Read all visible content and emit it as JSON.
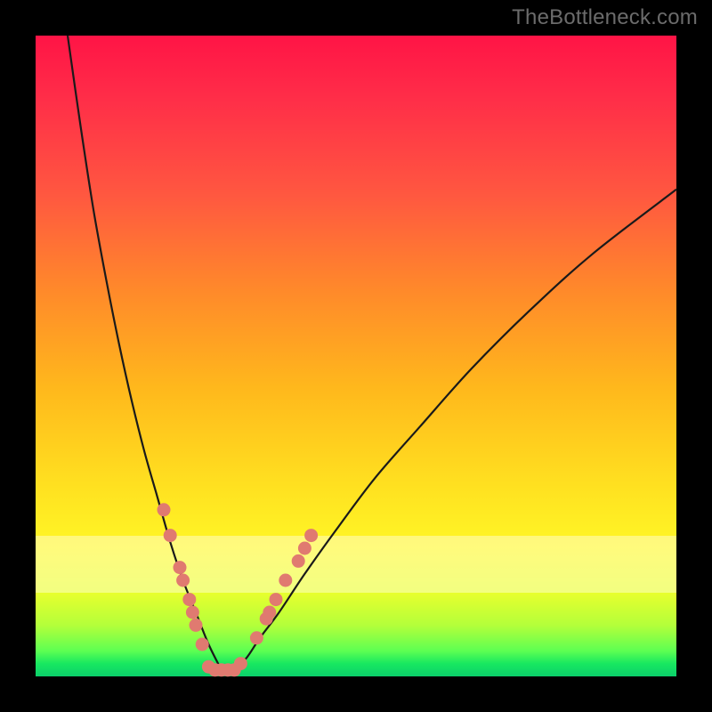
{
  "watermark": "TheBottleneck.com",
  "colors": {
    "background_frame": "#000000",
    "gradient_top": "#ff1446",
    "gradient_mid1": "#ff8a2a",
    "gradient_mid2": "#ffe020",
    "gradient_bottom": "#0bcf6a",
    "curve": "#1a1a1a",
    "marker": "#e07a70"
  },
  "chart_data": {
    "type": "line",
    "title": "",
    "xlabel": "",
    "ylabel": "",
    "xlim": [
      0,
      100
    ],
    "ylim": [
      0,
      100
    ],
    "grid": false,
    "legend": false,
    "annotations": [
      "TheBottleneck.com"
    ],
    "comment": "V-shaped bottleneck curve. y ≈ 100 is bottom of image (green/good, 0% bottleneck); y ≈ 0 is top (red/bad, 100% bottleneck). Minimum of the curve (best match) occurs around x ≈ 27–31. Left branch falls steeply from top-left; right branch rises more gently toward upper-right.",
    "series": [
      {
        "name": "bottleneck-curve-left-branch",
        "x": [
          5,
          7,
          9,
          11,
          13,
          15,
          17,
          19,
          21,
          23,
          25,
          27,
          29
        ],
        "y": [
          0,
          14,
          27,
          38,
          48,
          57,
          65,
          72,
          79,
          85,
          90,
          95,
          99
        ]
      },
      {
        "name": "bottleneck-curve-right-branch",
        "x": [
          29,
          31,
          33,
          35,
          38,
          42,
          47,
          53,
          60,
          68,
          77,
          87,
          100
        ],
        "y": [
          99,
          99,
          97,
          94,
          90,
          84,
          77,
          69,
          61,
          52,
          43,
          34,
          24
        ]
      }
    ],
    "markers": {
      "comment": "Salmon-colored dots and short segments clustered near the bottom of the V on both branches.",
      "points": [
        {
          "x": 20,
          "y": 74
        },
        {
          "x": 21,
          "y": 78
        },
        {
          "x": 22.5,
          "y": 83
        },
        {
          "x": 23,
          "y": 85
        },
        {
          "x": 24,
          "y": 88
        },
        {
          "x": 24.5,
          "y": 90
        },
        {
          "x": 25,
          "y": 92
        },
        {
          "x": 26,
          "y": 95
        },
        {
          "x": 27,
          "y": 98.5
        },
        {
          "x": 28,
          "y": 99
        },
        {
          "x": 29,
          "y": 99
        },
        {
          "x": 30,
          "y": 99
        },
        {
          "x": 31,
          "y": 99
        },
        {
          "x": 32,
          "y": 98
        },
        {
          "x": 34.5,
          "y": 94
        },
        {
          "x": 36,
          "y": 91
        },
        {
          "x": 36.5,
          "y": 90
        },
        {
          "x": 37.5,
          "y": 88
        },
        {
          "x": 39,
          "y": 85
        },
        {
          "x": 41,
          "y": 82
        },
        {
          "x": 42,
          "y": 80
        },
        {
          "x": 43,
          "y": 78
        }
      ]
    }
  }
}
